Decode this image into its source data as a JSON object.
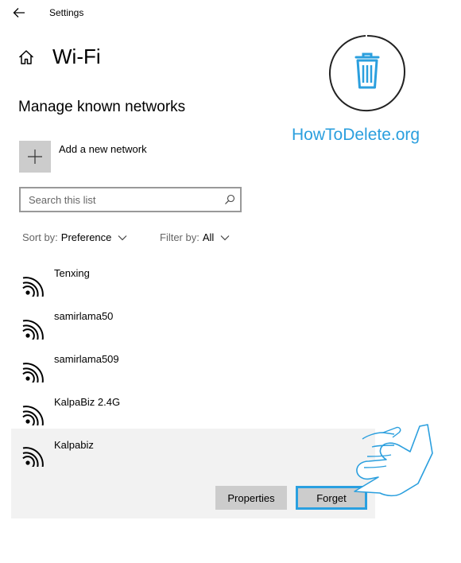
{
  "window": {
    "title": "Settings"
  },
  "header": {
    "page_title": "Wi-Fi",
    "section_title": "Manage known networks"
  },
  "add_network": {
    "label": "Add a new network"
  },
  "search": {
    "placeholder": "Search this list",
    "value": ""
  },
  "sort": {
    "label": "Sort by:",
    "value": "Preference"
  },
  "filter": {
    "label": "Filter by:",
    "value": "All"
  },
  "networks": [
    {
      "name": "Tenxing"
    },
    {
      "name": "samirlama50"
    },
    {
      "name": "samirlama509"
    },
    {
      "name": "KalpaBiz 2.4G"
    },
    {
      "name": "Kalpabiz",
      "selected": true
    }
  ],
  "actions": {
    "properties_label": "Properties",
    "forget_label": "Forget"
  },
  "watermark": {
    "text": "HowToDelete.org"
  },
  "colors": {
    "accent": "#2aa0e0",
    "tile_gray": "#cccccc",
    "selected_bg": "#f2f2f2"
  },
  "icons": [
    "back-arrow-icon",
    "home-icon",
    "plus-icon",
    "search-icon",
    "chevron-down-icon",
    "wifi-icon",
    "trash-icon",
    "hand-pointer-icon"
  ]
}
